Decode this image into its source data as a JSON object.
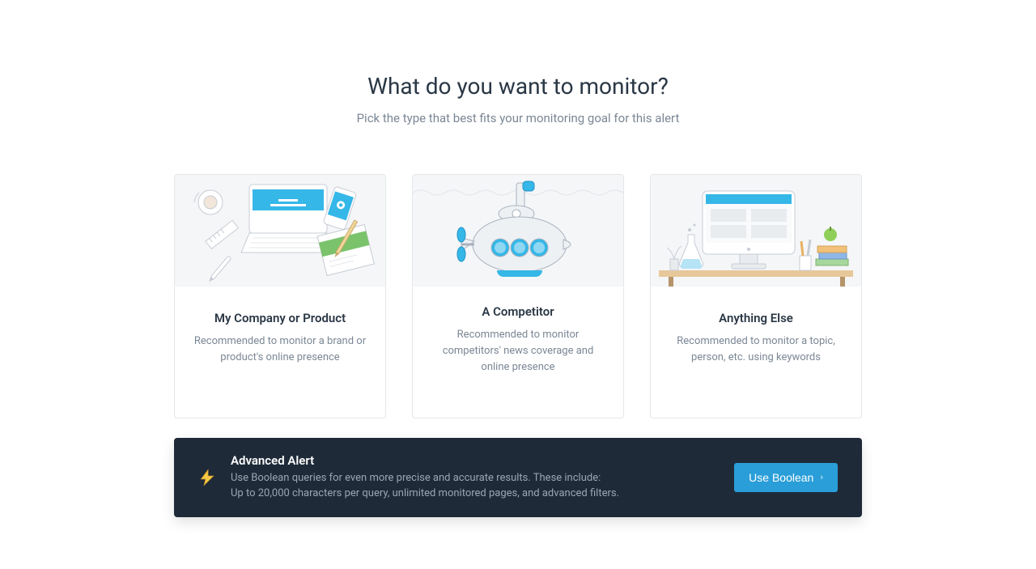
{
  "header": {
    "title": "What do you want to monitor?",
    "subtitle": "Pick the type that best fits your monitoring goal for this alert"
  },
  "cards": [
    {
      "title": "My Company or Product",
      "description": "Recommended to monitor a brand or product's online presence"
    },
    {
      "title": "A Competitor",
      "description": "Recommended to monitor competitors' news coverage and online presence"
    },
    {
      "title": "Anything Else",
      "description": "Recommended to monitor a topic, person, etc. using keywords"
    }
  ],
  "advanced": {
    "title": "Advanced Alert",
    "description_line1": "Use Boolean queries for even more precise and accurate results. These include:",
    "description_line2": "Up to 20,000 characters per query, unlimited monitored pages, and advanced filters.",
    "button_label": "Use Boolean"
  },
  "icons": {
    "lightning": "lightning-icon",
    "chevron_right": "chevron-right-icon"
  }
}
